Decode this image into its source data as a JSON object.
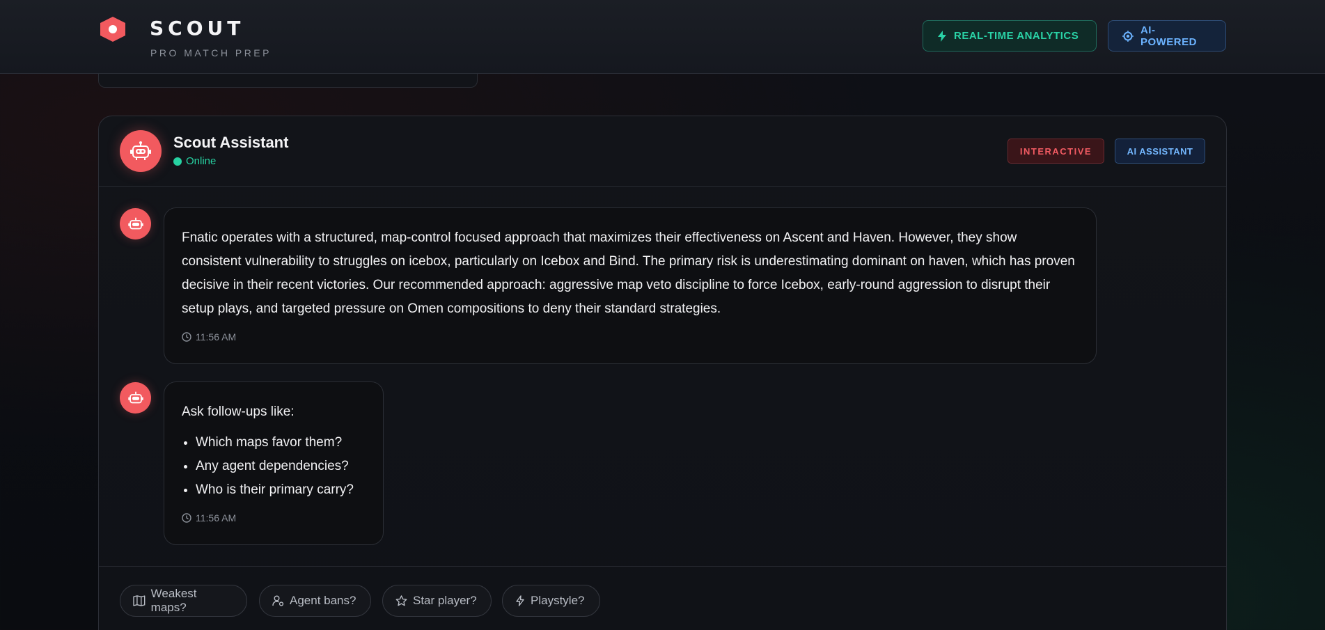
{
  "header": {
    "brand_title": "SCOUT",
    "brand_subtitle": "PRO MATCH PREP",
    "badges": [
      {
        "label": "REAL-TIME ANALYTICS",
        "icon": "lightning-icon",
        "color": "#2ad3a7"
      },
      {
        "label": "AI-POWERED",
        "icon": "ai-chip-icon",
        "color": "#6cb3ff"
      }
    ]
  },
  "assistant": {
    "name": "Scout Assistant",
    "status": "Online",
    "tags": [
      "INTERACTIVE",
      "AI ASSISTANT"
    ]
  },
  "messages": [
    {
      "text": "Fnatic operates with a structured, map-control focused approach that maximizes their effectiveness on Ascent and Haven. However, they show consistent vulnerability to struggles on icebox, particularly on Icebox and Bind. The primary risk is underestimating dominant on haven, which has proven decisive in their recent victories. Our recommended approach: aggressive map veto discipline to force Icebox, early-round aggression to disrupt their setup plays, and targeted pressure on Omen compositions to deny their standard strategies.",
      "time": "11:56 AM"
    },
    {
      "intro": "Ask follow-ups like:",
      "items": [
        "Which maps favor them?",
        "Any agent dependencies?",
        "Who is their primary carry?"
      ],
      "time": "11:56 AM"
    }
  ],
  "suggestions": [
    {
      "label": "Weakest maps?",
      "icon": "map-icon"
    },
    {
      "label": "Agent bans?",
      "icon": "user-settings-icon"
    },
    {
      "label": "Star player?",
      "icon": "star-icon"
    },
    {
      "label": "Playstyle?",
      "icon": "lightning-icon"
    }
  ],
  "colors": {
    "accent": "#f25a5f",
    "online": "#27d2a2"
  }
}
